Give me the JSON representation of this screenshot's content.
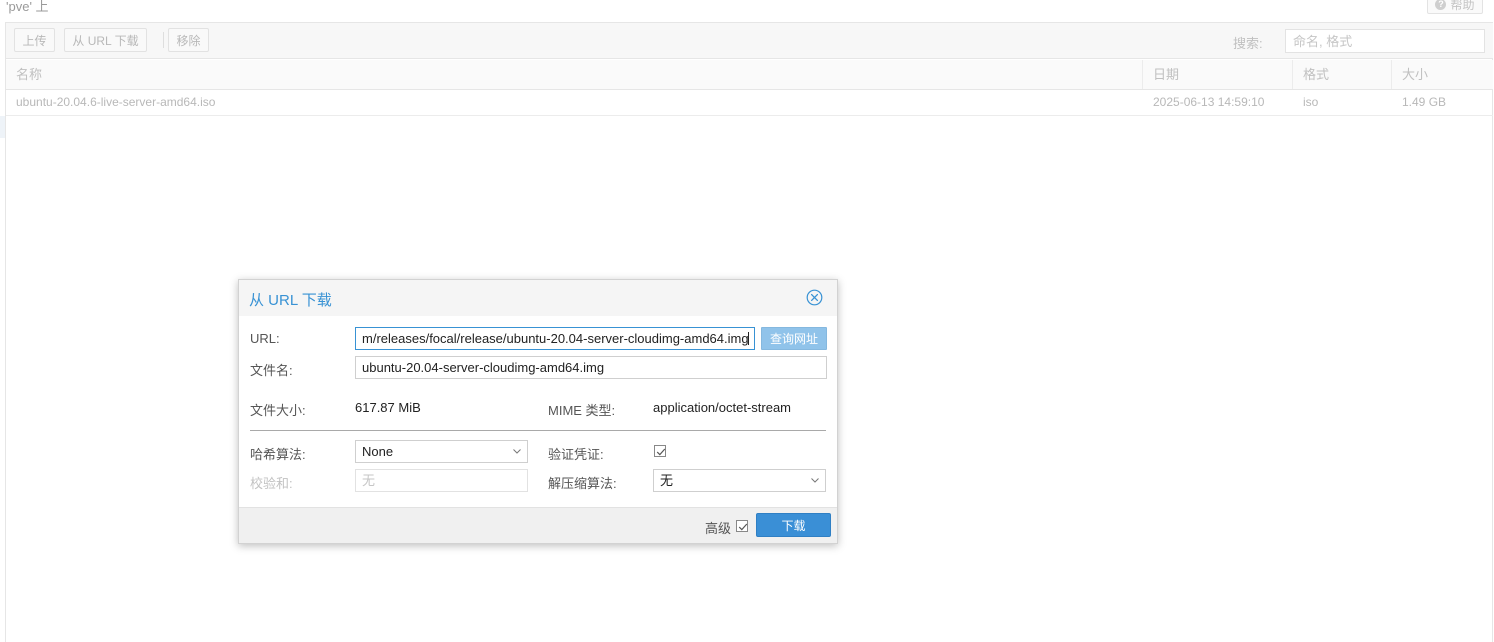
{
  "panel": {
    "title": "'pve' 上",
    "help_label": "帮助"
  },
  "toolbar": {
    "upload_label": "上传",
    "download_url_label": "从 URL 下载",
    "remove_label": "移除",
    "search_label": "搜索:",
    "search_placeholder": "命名, 格式"
  },
  "grid": {
    "columns": [
      "名称",
      "日期",
      "格式",
      "大小"
    ],
    "rows": [
      {
        "name": "ubuntu-20.04.6-live-server-amd64.iso",
        "date": "2025-06-13 14:59:10",
        "format": "iso",
        "size": "1.49 GB"
      }
    ]
  },
  "dialog": {
    "title": "从 URL 下载",
    "url_label": "URL:",
    "url_value": "m/releases/focal/release/ubuntu-20.04-server-cloudimg-amd64.img",
    "query_button": "查询网址",
    "filename_label": "文件名:",
    "filename_value": "ubuntu-20.04-server-cloudimg-amd64.img",
    "filesize_label": "文件大小:",
    "filesize_value": "617.87 MiB",
    "mime_label": "MIME 类型:",
    "mime_value": "application/octet-stream",
    "hash_label": "哈希算法:",
    "hash_value": "None",
    "verify_label": "验证凭证:",
    "verify_checked": true,
    "checksum_label": "校验和:",
    "checksum_placeholder": "无",
    "decompress_label": "解压缩算法:",
    "decompress_value": "无",
    "advanced_label": "高级",
    "advanced_checked": true,
    "download_button": "下载"
  },
  "colors": {
    "accent": "#3892d4",
    "button_primary": "#3a8fd6",
    "button_disabled": "#90c3ea"
  }
}
